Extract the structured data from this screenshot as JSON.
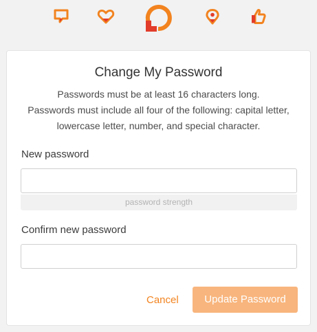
{
  "header": {
    "icons": [
      {
        "name": "speech-bubble-icon",
        "color": "#f2831f"
      },
      {
        "name": "heart-icon",
        "color": "#f2831f"
      },
      {
        "name": "app-logo",
        "color": "#ef5a24"
      },
      {
        "name": "location-pin-icon",
        "color": "#f2831f"
      },
      {
        "name": "thumbs-up-icon",
        "color": "#f2831f"
      }
    ]
  },
  "form": {
    "title": "Change My Password",
    "description_line_1": "Passwords must be at least 16 characters long.",
    "description_line_2": "Passwords must include all four of the following: capital letter, lowercase letter, number, and special character.",
    "new_password_label": "New password",
    "new_password_value": "",
    "strength_label": "password strength",
    "confirm_password_label": "Confirm new password",
    "confirm_password_value": "",
    "cancel_label": "Cancel",
    "submit_label": "Update Password"
  },
  "colors": {
    "accent": "#f2831f",
    "button_background": "#f8b57d",
    "logo_red": "#e23c2b"
  }
}
